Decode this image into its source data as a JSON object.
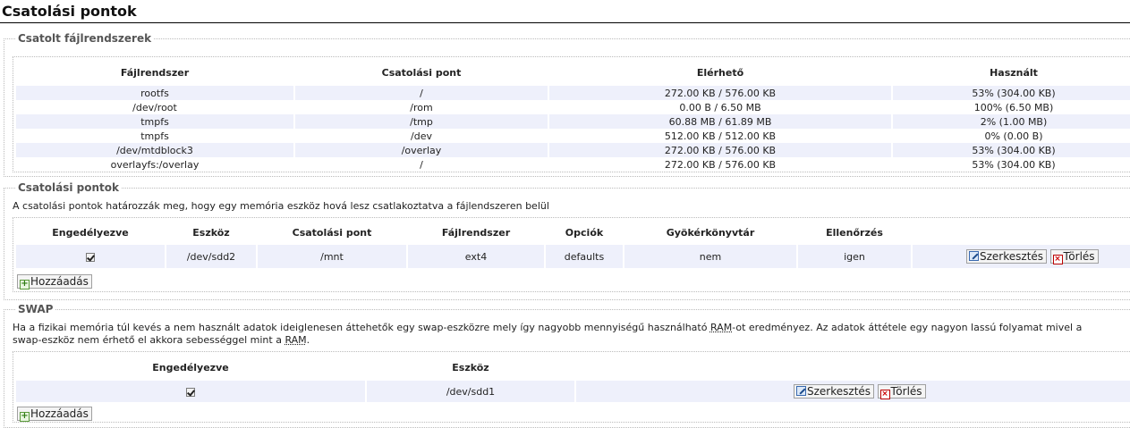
{
  "page": {
    "title": "Csatolási pontok"
  },
  "mounted": {
    "legend": "Csatolt fájlrendszerek",
    "headers": [
      "Fájlrendszer",
      "Csatolási pont",
      "Elérhető",
      "Használt"
    ],
    "rows": [
      [
        "rootfs",
        "/",
        "272.00 KB / 576.00 KB",
        "53% (304.00 KB)"
      ],
      [
        "/dev/root",
        "/rom",
        "0.00 B / 6.50 MB",
        "100% (6.50 MB)"
      ],
      [
        "tmpfs",
        "/tmp",
        "60.88 MB / 61.89 MB",
        "2% (1.00 MB)"
      ],
      [
        "tmpfs",
        "/dev",
        "512.00 KB / 512.00 KB",
        "0% (0.00 B)"
      ],
      [
        "/dev/mtdblock3",
        "/overlay",
        "272.00 KB / 576.00 KB",
        "53% (304.00 KB)"
      ],
      [
        "overlayfs:/overlay",
        "/",
        "272.00 KB / 576.00 KB",
        "53% (304.00 KB)"
      ]
    ]
  },
  "mountpoints": {
    "legend": "Csatolási pontok",
    "description": "A csatolási pontok határozzák meg, hogy egy memória eszköz hová lesz csatlakoztatva a fájlendszeren belül",
    "headers": [
      "Engedélyezve",
      "Eszköz",
      "Csatolási pont",
      "Fájlrendszer",
      "Opciók",
      "Gyökérkönyvtár",
      "Ellenőrzés"
    ],
    "rows": [
      {
        "enabled": true,
        "device": "/dev/sdd2",
        "mountpoint": "/mnt",
        "fs": "ext4",
        "options": "defaults",
        "rootfs": "nem",
        "check": "igen"
      }
    ],
    "edit_label": "Szerkesztés",
    "delete_label": "Törlés",
    "add_label": "Hozzáadás"
  },
  "swap": {
    "legend": "SWAP",
    "description_1": "Ha a fizikai memória túl kevés a nem használt adatok ideiglenesen áttehetők egy swap-eszközre mely így nagyobb mennyiségű használható ",
    "abbr_ram": "RAM",
    "description_2": "-ot eredményez. Az adatok áttétele egy nagyon lassú folyamat mivel a",
    "description_3": "swap-eszköz nem érhető el akkora sebességgel mint a ",
    "description_4": ".",
    "headers": [
      "Engedélyezve",
      "Eszköz"
    ],
    "rows": [
      {
        "enabled": true,
        "device": "/dev/sdd1"
      }
    ],
    "edit_label": "Szerkesztés",
    "delete_label": "Törlés",
    "add_label": "Hozzáadás"
  },
  "icons": {
    "edit": "edit-icon",
    "delete": "delete-icon",
    "add": "add-icon"
  }
}
